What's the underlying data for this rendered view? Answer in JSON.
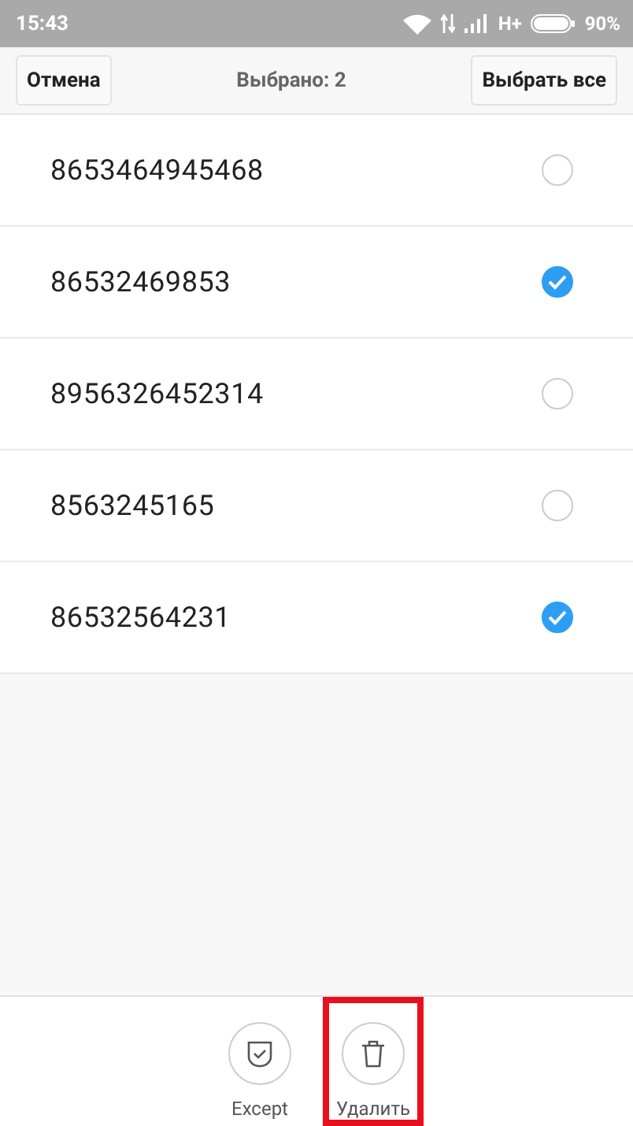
{
  "status_bar": {
    "time": "15:43",
    "network": "H+",
    "battery": "90%"
  },
  "header": {
    "cancel": "Отмена",
    "title": "Выбрано: 2",
    "select_all": "Выбрать все"
  },
  "rows": [
    {
      "number": "8653464945468",
      "selected": false
    },
    {
      "number": "86532469853",
      "selected": true
    },
    {
      "number": "8956326452314",
      "selected": false
    },
    {
      "number": "8563245165",
      "selected": false
    },
    {
      "number": "86532564231",
      "selected": true
    }
  ],
  "actions": [
    {
      "kind": "shield",
      "label": "Except",
      "highlighted": false
    },
    {
      "kind": "trash",
      "label": "Удалить",
      "highlighted": true
    }
  ]
}
